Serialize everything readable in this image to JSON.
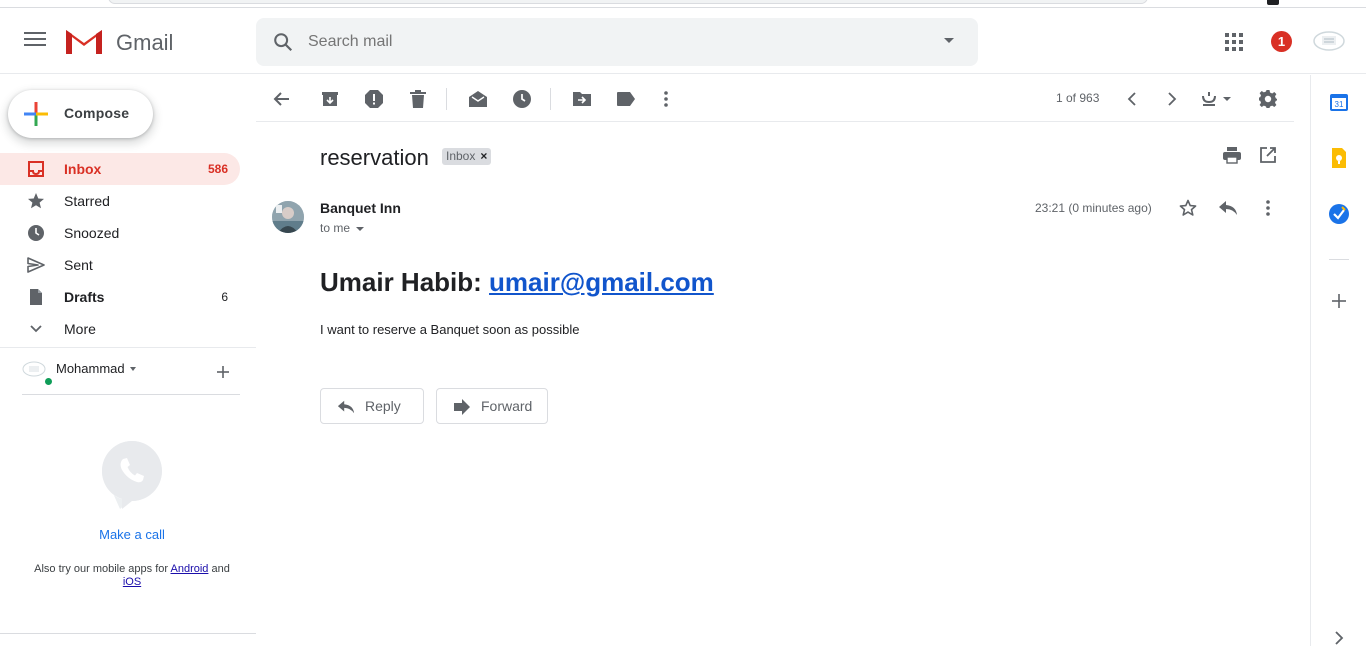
{
  "app": {
    "name": "Gmail"
  },
  "search": {
    "placeholder": "Search mail"
  },
  "header": {
    "notification_count": "1"
  },
  "compose": {
    "label": "Compose"
  },
  "nav": {
    "items": [
      {
        "label": "Inbox",
        "count": "586"
      },
      {
        "label": "Starred",
        "count": ""
      },
      {
        "label": "Snoozed",
        "count": ""
      },
      {
        "label": "Sent",
        "count": ""
      },
      {
        "label": "Drafts",
        "count": "6"
      },
      {
        "label": "More",
        "count": ""
      }
    ]
  },
  "hangouts": {
    "user": "Mohammad",
    "make_call": "Make a call",
    "mobile_prefix": "Also try our mobile apps for",
    "android": "Android",
    "and": "and",
    "ios": "iOS"
  },
  "toolbar": {
    "page_info": "1 of 963"
  },
  "message": {
    "subject": "reservation",
    "label": "Inbox",
    "label_remove": "×",
    "sender": "Banquet Inn",
    "recipient": "to me",
    "timestamp": "23:21 (0 minutes ago)",
    "body_name": "Umair Habib:",
    "body_email": "umair@gmail.com",
    "body_text": "I want to reserve a Banquet soon as possible"
  },
  "actions": {
    "reply": "Reply",
    "forward": "Forward"
  },
  "rail": {
    "calendar_day": "31"
  },
  "colors": {
    "accent_red": "#d93025",
    "active_bg": "#fce8e6",
    "link_blue": "#1155cc"
  }
}
